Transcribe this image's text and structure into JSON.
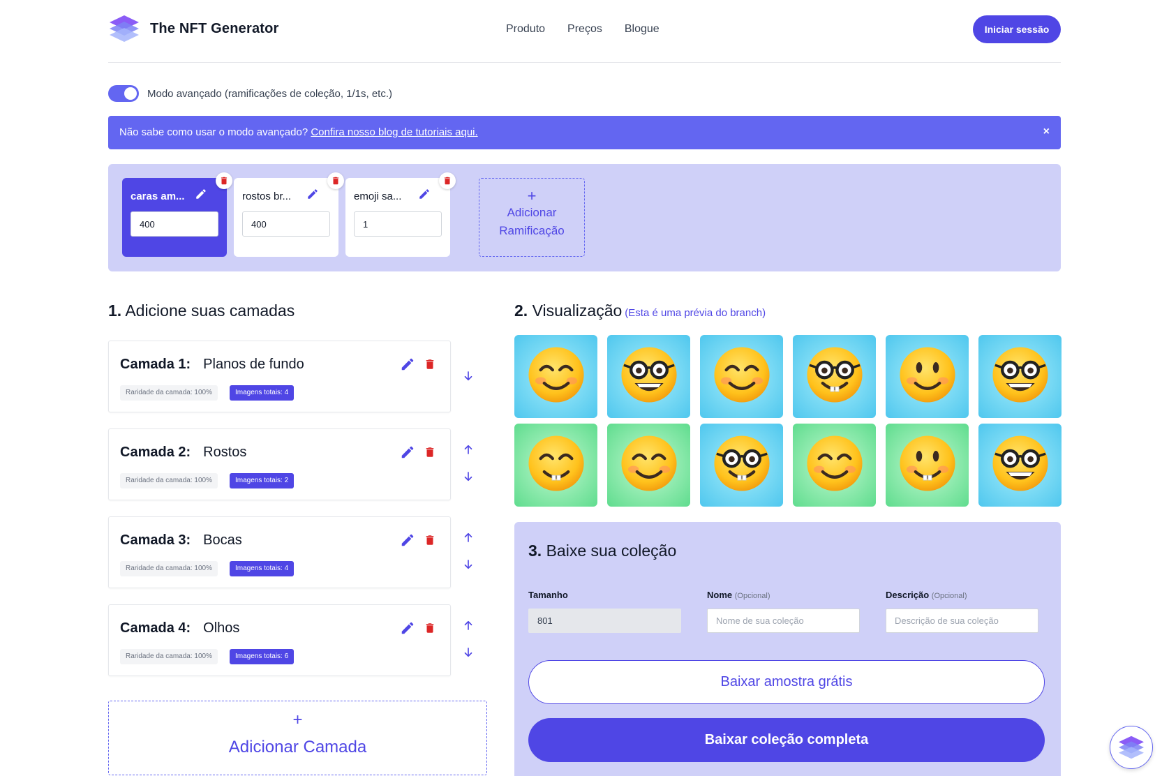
{
  "header": {
    "brand": "The NFT Generator",
    "nav": [
      "Produto",
      "Preços",
      "Blogue"
    ],
    "login": "Iniciar sessão"
  },
  "advanced_mode": {
    "enabled": true,
    "label": "Modo avançado (ramificações de coleção, 1/1s, etc.)"
  },
  "banner": {
    "text": "Não sabe como usar o modo avançado?",
    "link": "Confira nosso blog de tutoriais aqui.",
    "close": "×"
  },
  "branches": [
    {
      "name": "caras am...",
      "value": "400",
      "active": true
    },
    {
      "name": "rostos br...",
      "value": "400",
      "active": false
    },
    {
      "name": "emoji sa...",
      "value": "1",
      "active": false
    }
  ],
  "add_branch": {
    "plus": "+",
    "line1": "Adicionar",
    "line2": "Ramificação"
  },
  "section1": {
    "num": "1.",
    "title": "Adicione suas camadas"
  },
  "layers": [
    {
      "label": "Camada 1:",
      "name": "Planos de fundo",
      "rarity": "Raridade da camada: 100%",
      "total": "Imagens totais: 4"
    },
    {
      "label": "Camada 2:",
      "name": "Rostos",
      "rarity": "Raridade da camada: 100%",
      "total": "Imagens totais: 2"
    },
    {
      "label": "Camada 3:",
      "name": "Bocas",
      "rarity": "Raridade da camada: 100%",
      "total": "Imagens totais: 4"
    },
    {
      "label": "Camada 4:",
      "name": "Olhos",
      "rarity": "Raridade da camada: 100%",
      "total": "Imagens totais: 6"
    }
  ],
  "add_layer": {
    "plus": "+",
    "label": "Adicionar Camada"
  },
  "section2": {
    "num": "2.",
    "title": "Visualização",
    "subtitle": "(Esta é uma prévia do branch)"
  },
  "preview": [
    {
      "bg": "blue",
      "face": "smile-blush"
    },
    {
      "bg": "blue",
      "face": "glasses-grin"
    },
    {
      "bg": "blue",
      "face": "smile-blush"
    },
    {
      "bg": "blue",
      "face": "glasses-teeth"
    },
    {
      "bg": "blue",
      "face": "dot-eyes"
    },
    {
      "bg": "blue",
      "face": "glasses-grin"
    },
    {
      "bg": "green",
      "face": "teeth-smile"
    },
    {
      "bg": "green",
      "face": "smile-blush"
    },
    {
      "bg": "blue",
      "face": "glasses-teeth"
    },
    {
      "bg": "green",
      "face": "smile-blush"
    },
    {
      "bg": "green",
      "face": "dot-eyes-teeth"
    },
    {
      "bg": "blue",
      "face": "glasses-grin"
    }
  ],
  "section3": {
    "num": "3.",
    "title": "Baixe sua coleção",
    "size_label": "Tamanho",
    "size_value": "801",
    "name_label": "Nome",
    "name_opt": "(Opcional)",
    "name_placeholder": "Nome de sua coleção",
    "desc_label": "Descrição",
    "desc_opt": "(Opcional)",
    "desc_placeholder": "Descrição de sua coleção",
    "btn_sample": "Baixar amostra grátis",
    "btn_full": "Baixar coleção completa"
  },
  "colors": {
    "accent": "#4f46e5",
    "banner": "#6366f1",
    "panel": "#cfd0f8",
    "delete": "#dc2626"
  }
}
